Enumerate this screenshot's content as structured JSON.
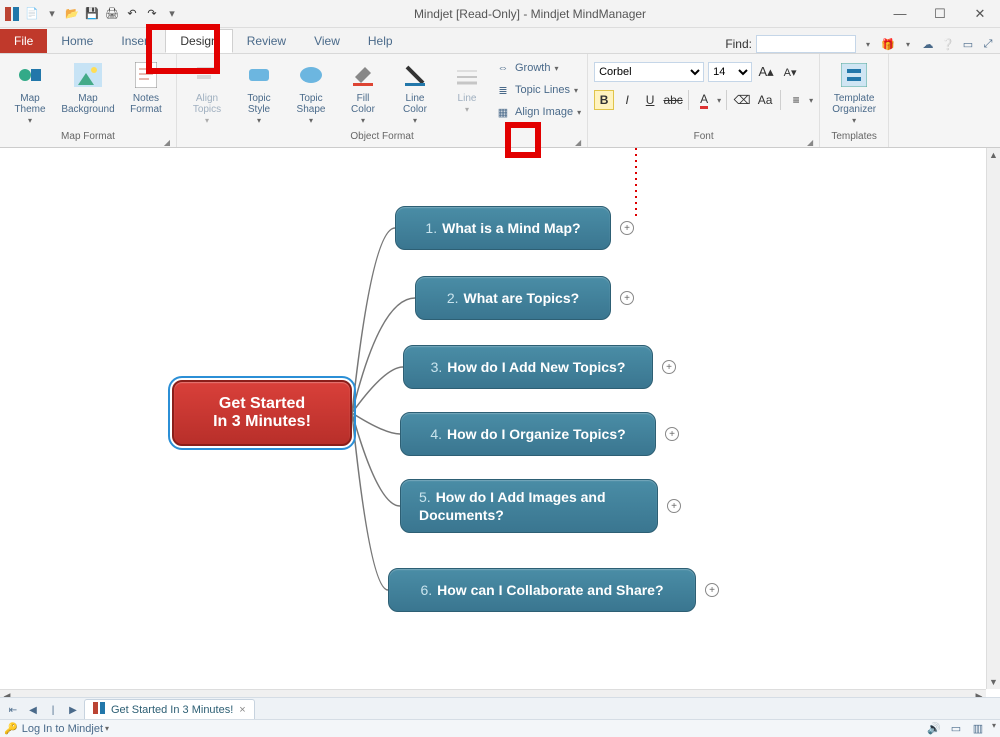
{
  "title": "Mindjet [Read-Only] - Mindjet MindManager",
  "tabs": {
    "file": "File",
    "home": "Home",
    "insert": "Insert",
    "design": "Design",
    "review": "Review",
    "view": "View",
    "help": "Help"
  },
  "find_label": "Find:",
  "ribbon": {
    "map_format": {
      "label": "Map Format",
      "theme": "Map\nTheme",
      "background": "Map\nBackground",
      "notes": "Notes\nFormat"
    },
    "object_format": {
      "label": "Object Format",
      "align": "Align\nTopics",
      "topic_style": "Topic\nStyle",
      "topic_shape": "Topic\nShape",
      "fill": "Fill\nColor",
      "line_color": "Line\nColor",
      "line": "Line",
      "growth": "Growth",
      "topic_lines": "Topic Lines",
      "align_image": "Align Image"
    },
    "font": {
      "label": "Font",
      "name": "Corbel",
      "size": "14"
    },
    "templates": {
      "label": "Templates",
      "organizer": "Template\nOrganizer"
    }
  },
  "central": {
    "line1": "Get Started",
    "line2": "In 3 Minutes!"
  },
  "topics": [
    {
      "n": "1.",
      "t": "What is a Mind Map?"
    },
    {
      "n": "2.",
      "t": "What are Topics?"
    },
    {
      "n": "3.",
      "t": "How do I Add New Topics?"
    },
    {
      "n": "4.",
      "t": "How do I Organize Topics?"
    },
    {
      "n": "5.",
      "t": "How do I Add Images and Documents?"
    },
    {
      "n": "6.",
      "t": "How can I Collaborate and Share?"
    }
  ],
  "doctab": "Get Started In 3 Minutes!",
  "status_login": "Log In to Mindjet"
}
